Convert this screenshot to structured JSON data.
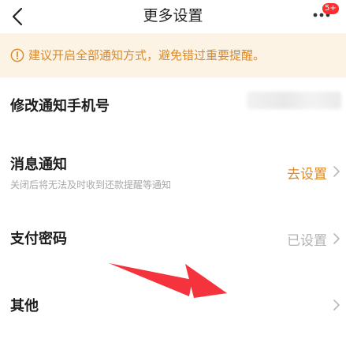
{
  "header": {
    "title": "更多设置",
    "badge": "5+",
    "icons": {
      "back": "chevron-left-icon",
      "more": "more-dots-icon"
    }
  },
  "notice": {
    "icon": "warning-circle-icon",
    "text": "建议开启全部通知方式，避免错过重要提醒。",
    "color": "#d98a2b",
    "background": "#fdf3e5"
  },
  "settings": {
    "phone": {
      "label": "修改通知手机号"
    },
    "notifications": {
      "label": "消息通知",
      "description": "关闭后将无法及时收到还款提醒等通知",
      "value": "去设置",
      "value_color": "#d98a2b"
    },
    "payment_password": {
      "label": "支付密码",
      "value": "已设置",
      "value_color": "#b3b3b3"
    },
    "other": {
      "label": "其他"
    }
  },
  "annotation": {
    "icon": "red-arrow-icon",
    "color": "#f4333c"
  }
}
